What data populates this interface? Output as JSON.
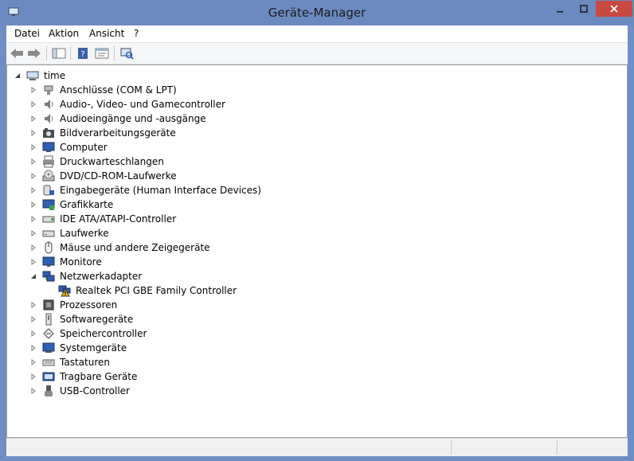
{
  "window": {
    "title": "Geräte-Manager"
  },
  "menu": {
    "items": [
      "Datei",
      "Aktion",
      "Ansicht",
      "?"
    ]
  },
  "tree": {
    "root": "time",
    "categories": [
      {
        "label": "Anschlüsse (COM & LPT)",
        "icon": "port-icon",
        "expanded": false
      },
      {
        "label": "Audio-, Video- und Gamecontroller",
        "icon": "speaker-icon",
        "expanded": false
      },
      {
        "label": "Audioeingänge und -ausgänge",
        "icon": "speaker-icon",
        "expanded": false
      },
      {
        "label": "Bildverarbeitungsgeräte",
        "icon": "camera-icon",
        "expanded": false
      },
      {
        "label": "Computer",
        "icon": "computer-icon",
        "expanded": false
      },
      {
        "label": "Druckwarteschlangen",
        "icon": "printer-icon",
        "expanded": false
      },
      {
        "label": "DVD/CD-ROM-Laufwerke",
        "icon": "disc-drive-icon",
        "expanded": false
      },
      {
        "label": "Eingabegeräte (Human Interface Devices)",
        "icon": "hid-icon",
        "expanded": false
      },
      {
        "label": "Grafikkarte",
        "icon": "display-adapter-icon",
        "expanded": false
      },
      {
        "label": "IDE ATA/ATAPI-Controller",
        "icon": "ide-controller-icon",
        "expanded": false
      },
      {
        "label": "Laufwerke",
        "icon": "disk-drive-icon",
        "expanded": false
      },
      {
        "label": "Mäuse und andere Zeigegeräte",
        "icon": "mouse-icon",
        "expanded": false
      },
      {
        "label": "Monitore",
        "icon": "monitor-icon",
        "expanded": false
      },
      {
        "label": "Netzwerkadapter",
        "icon": "network-adapter-icon",
        "expanded": true,
        "children": [
          {
            "label": "Realtek PCI GBE Family Controller",
            "icon": "warning-network-icon"
          }
        ]
      },
      {
        "label": "Prozessoren",
        "icon": "processor-icon",
        "expanded": false
      },
      {
        "label": "Softwaregeräte",
        "icon": "software-device-icon",
        "expanded": false
      },
      {
        "label": "Speichercontroller",
        "icon": "storage-controller-icon",
        "expanded": false
      },
      {
        "label": "Systemgeräte",
        "icon": "system-device-icon",
        "expanded": false
      },
      {
        "label": "Tastaturen",
        "icon": "keyboard-icon",
        "expanded": false
      },
      {
        "label": "Tragbare Geräte",
        "icon": "portable-device-icon",
        "expanded": false
      },
      {
        "label": "USB-Controller",
        "icon": "usb-icon",
        "expanded": false
      }
    ]
  },
  "colors": {
    "titlebar": "#6b8ac0",
    "close": "#c7493f",
    "warning": "#f2c200"
  }
}
